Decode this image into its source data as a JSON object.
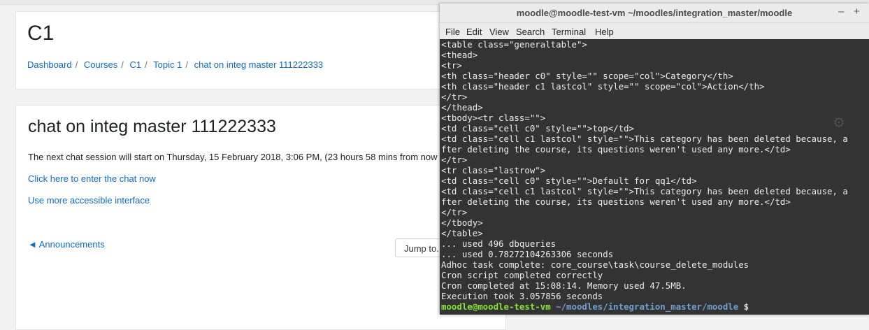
{
  "moodle": {
    "course_title": "C1",
    "breadcrumb": [
      "Dashboard",
      "Courses",
      "C1",
      "Topic 1",
      "chat on integ master 111222333"
    ],
    "activity_title": "chat on integ master 111222333",
    "session_text": "The next chat session will start on Thursday, 15 February 2018, 3:06 PM, (23 hours 58 mins from now",
    "enter_chat_link": "Click here to enter the chat now",
    "accessible_link": "Use more accessible interface",
    "prev_activity_link": "◄ Announcements",
    "jump_to": "Jump to..."
  },
  "terminal": {
    "title": "moodle@moodle-test-vm ~/moodles/integration_master/moodle",
    "window_buttons": {
      "minimize": "–",
      "maximize": "+"
    },
    "menu": [
      "File",
      "Edit",
      "View",
      "Search",
      "Terminal",
      "Help"
    ],
    "lines": [
      "<table class=\"generaltable\">",
      "<thead>",
      "<tr>",
      "<th class=\"header c0\" style=\"\" scope=\"col\">Category</th>",
      "<th class=\"header c1 lastcol\" style=\"\" scope=\"col\">Action</th>",
      "</tr>",
      "</thead>",
      "<tbody><tr class=\"\">",
      "<td class=\"cell c0\" style=\"\">top</td>",
      "<td class=\"cell c1 lastcol\" style=\"\">This category has been deleted because, a",
      "fter deleting the course, its questions weren't used any more.</td>",
      "</tr>",
      "<tr class=\"lastrow\">",
      "<td class=\"cell c0\" style=\"\">Default for qq1</td>",
      "<td class=\"cell c1 lastcol\" style=\"\">This category has been deleted because, a",
      "fter deleting the course, its questions weren't used any more.</td>",
      "</tr>",
      "</tbody>",
      "</table>",
      "... used 496 dbqueries",
      "... used 0.78272104263306 seconds",
      "Adhoc task complete: core_course\\task\\course_delete_modules",
      "Cron script completed correctly",
      "Cron completed at 15:08:14. Memory used 47.5MB.",
      "Execution took 3.057856 seconds"
    ],
    "prompt": {
      "user": "moodle@moodle-test-vm",
      "path": " ~/moodles/integration_master/moodle",
      "sign": " $"
    }
  },
  "colors": {
    "link": "#0f6cbf",
    "terminal_bg": "#333333",
    "prompt_user": "#8ae234",
    "prompt_path": "#729fcf"
  }
}
